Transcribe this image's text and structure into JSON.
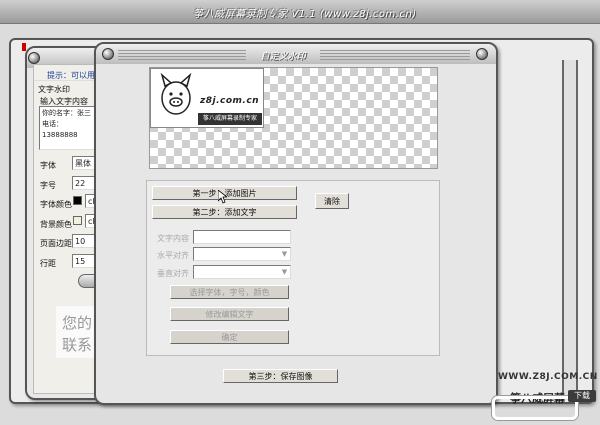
{
  "app": {
    "title": "筝八威屏幕录制专家 V1.1 (www.z8j.com.cn)"
  },
  "back_window": {
    "hint": "提示：可以用以",
    "tab_label": "文字水印",
    "section_label": "输入文字内容",
    "text_content": [
      "你的名字：张三",
      "电话：13888888"
    ],
    "font_label": "字体",
    "font_value": "黑体",
    "size_label": "字号",
    "size_value": "22",
    "color_label": "字体颜色",
    "color_value": "cl",
    "bgcolor_label": "背景颜色",
    "bgcolor_value": "cl",
    "margin_label": "页面边距",
    "margin_value": "10",
    "spacing_label": "行距",
    "spacing_value": "15",
    "preview_text": [
      "您的",
      "联系"
    ]
  },
  "dialog": {
    "title": "自定义水印",
    "logo": {
      "domain": "z8j.com.cn",
      "caption": "筝八威屏幕录制专家"
    },
    "step1_button": "第一步：添加图片",
    "step2_button": "第二步：添加文字",
    "clear_button": "清除",
    "text_content_label": "文字内容",
    "halign_label": "水平对齐",
    "valign_label": "垂直对齐",
    "font_button": "选择字体，字号，颜色",
    "edit_button": "修改编辑文字",
    "ok_button": "确定",
    "step3_button": "第三步：保存图像"
  },
  "watermark": {
    "url": "WWW.Z8J.COM.CN",
    "brand": "筝八威屏幕",
    "button": "下载"
  }
}
